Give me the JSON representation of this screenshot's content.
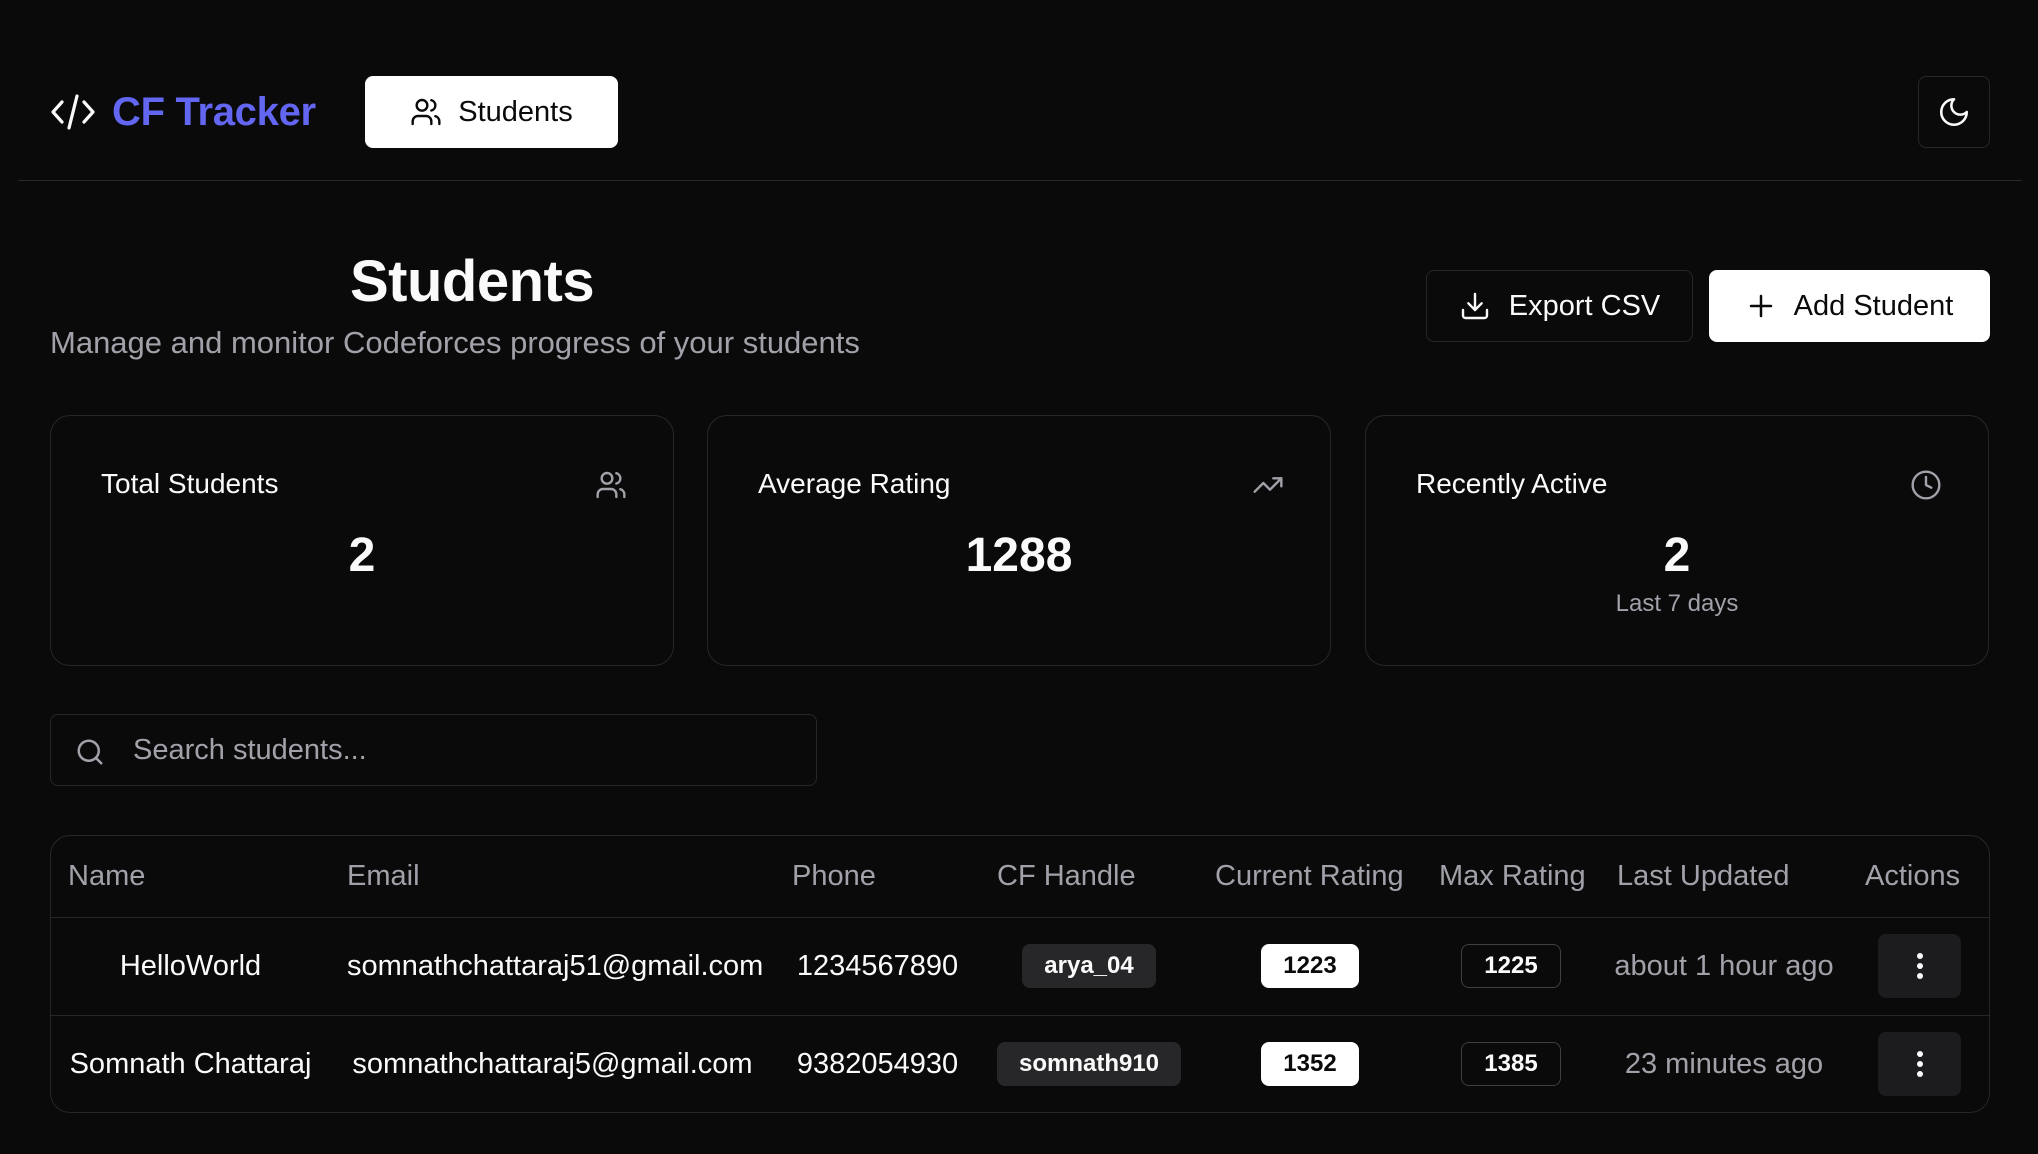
{
  "header": {
    "app_name": "CF Tracker",
    "nav_students": "Students"
  },
  "page": {
    "title": "Students",
    "subtitle": "Manage and monitor Codeforces progress of your students",
    "export_label": "Export CSV",
    "add_label": "Add Student"
  },
  "stats": [
    {
      "label": "Total Students",
      "value": "2",
      "icon": "users-icon"
    },
    {
      "label": "Average Rating",
      "value": "1288",
      "icon": "trending-up-icon"
    },
    {
      "label": "Recently Active",
      "value": "2",
      "note": "Last 7 days",
      "icon": "clock-icon"
    }
  ],
  "search": {
    "placeholder": "Search students...",
    "value": ""
  },
  "table": {
    "headers": [
      "Name",
      "Email",
      "Phone",
      "CF Handle",
      "Current Rating",
      "Max Rating",
      "Last Updated",
      "Actions"
    ],
    "rows": [
      {
        "name": "HelloWorld",
        "email": "somnathchattaraj51@gmail.com",
        "phone": "1234567890",
        "handle": "arya_04",
        "current_rating": "1223",
        "max_rating": "1225",
        "updated": "about 1 hour ago"
      },
      {
        "name": "Somnath Chattaraj",
        "email": "somnathchattaraj5@gmail.com",
        "phone": "9382054930",
        "handle": "somnath910",
        "current_rating": "1352",
        "max_rating": "1385",
        "updated": "23 minutes ago"
      }
    ]
  },
  "colors": {
    "background": "#0a0a0a",
    "brand": "#6366f1",
    "border": "#27272a",
    "muted_text": "#a1a1aa"
  }
}
